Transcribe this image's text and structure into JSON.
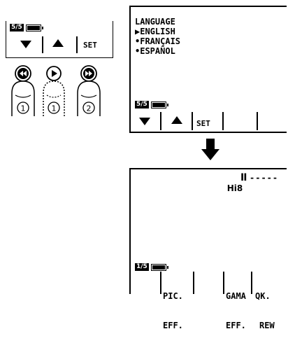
{
  "mini_panel": {
    "page_number": "5/5",
    "set_label": "SET"
  },
  "buttons": [
    {
      "icon": "rewind",
      "number": "①"
    },
    {
      "icon": "play",
      "number": "①"
    },
    {
      "icon": "fast-forward",
      "number": "②"
    }
  ],
  "language_screen": {
    "title": "LANGUAGE",
    "options": [
      "▶ENGLISH",
      "•FRANÇAIS",
      "•ESPAÑOL"
    ],
    "page_number": "5/5",
    "set_label": "SET"
  },
  "playback_screen": {
    "format": "Hi8",
    "pause_symbol": "II",
    "counter": "-----",
    "page_number": "1/5",
    "menu": [
      {
        "line1": "PIC.",
        "line2": "EFF."
      },
      {
        "line1": "GAMA",
        "line2": "EFF."
      },
      {
        "line1": "QK.",
        "line2": "REW"
      }
    ]
  }
}
